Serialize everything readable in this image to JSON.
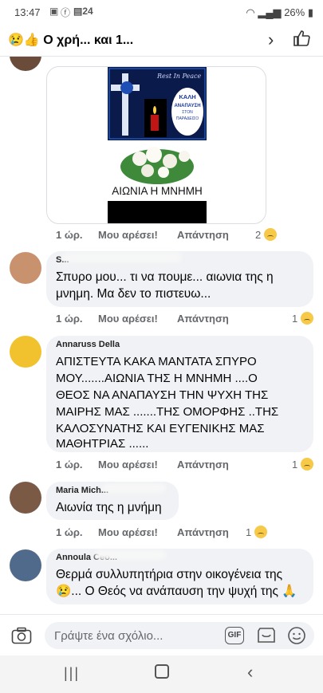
{
  "status_bar": {
    "time": "13:47",
    "battery": "26%"
  },
  "header": {
    "title": "😢👍 Ο χρή... και 1...",
    "chevron": "›"
  },
  "comments": [
    {
      "time": "1 ώρ.",
      "like": "Μου αρέσει!",
      "reply": "Απάντηση",
      "count": "2"
    },
    {
      "name": "S...",
      "text_lines": [
        "Σπυρο μου... τι να πουμε... αιωνια της η",
        "μνημη. Μα δεν το πιστευω..."
      ],
      "time": "1 ώρ.",
      "like": "Μου αρέσει!",
      "reply": "Απάντηση",
      "count": "1"
    },
    {
      "name": "Annaruss Della",
      "text_lines": [
        "ΑΠΙΣΤΕΥΤΑ ΚΑΚΑ ΜΑΝΤΑΤΑ ΣΠΥΡΟ",
        "ΜΟΥ.......ΑΙΩΝΙΑ ΤΗΣ Η ΜΝΗΜΗ ....Ο",
        "ΘΕΟΣ ΝΑ ΑΝΑΠΑΥΣΗ ΤΗΝ ΨΥΧΗ ΤΗΣ",
        "ΜΑΙΡΗΣ ΜΑΣ .......ΤΗΣ ΟΜΟΡΦΗΣ ..ΤΗΣ",
        "ΚΑΛΟΣΥΝΑΤΗΣ ΚΑΙ ΕΥΓΕΝΙΚΗΣ ΜΑΣ",
        "ΜΑΘΗΤΡΙΑΣ ......"
      ],
      "time": "1 ώρ.",
      "like": "Μου αρέσει!",
      "reply": "Απάντηση",
      "count": "1"
    },
    {
      "name": "Maria Mich...",
      "text_lines": [
        "Αιωνία της η μνήμη"
      ],
      "time": "1 ώρ.",
      "like": "Μου αρέσει!",
      "reply": "Απάντηση",
      "count": "1"
    },
    {
      "name": "Annoula Ceo...",
      "text_lines": [
        "Θερμά συλλυπητήρια στην οικογένεια της",
        "😢... Ο Θεός να ανάπαυση την ψυχή της 🙏"
      ]
    }
  ],
  "image": {
    "rip_text": "Rest In Peace",
    "badge_lines": [
      "ΚΑΛΗ",
      "ΑΝΑΠΑΥΣΗ",
      "ΣΤΟΝ",
      "ΠΑΡΑΔΕΙΣΟ"
    ],
    "caption": "ΑΙΩΝΙΑ Η ΜΝΗΜΗ"
  },
  "composer": {
    "placeholder": "Γράψτε ένα σχόλιο...",
    "gif": "GIF"
  }
}
